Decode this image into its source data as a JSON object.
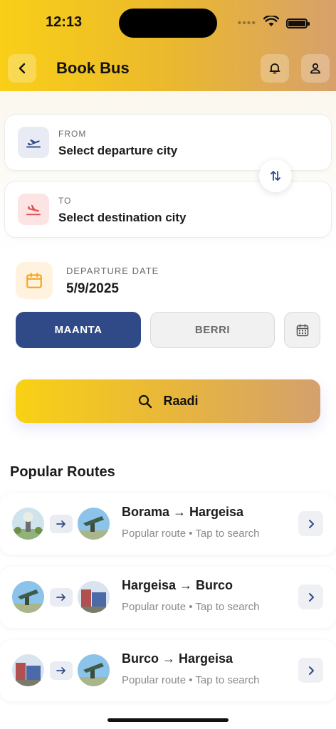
{
  "status_bar": {
    "time": "12:13",
    "signal_dots": "••••"
  },
  "header": {
    "title": "Book Bus"
  },
  "from": {
    "label": "FROM",
    "placeholder": "Select departure city"
  },
  "to": {
    "label": "TO",
    "placeholder": "Select destination city"
  },
  "date": {
    "label": "DEPARTURE DATE",
    "value": "5/9/2025"
  },
  "day_toggle": {
    "today_label": "MAANTA",
    "tomorrow_label": "BERRI"
  },
  "search": {
    "label": "Raadi"
  },
  "popular": {
    "title": "Popular Routes",
    "routes": [
      {
        "name": "Borama → Hargeisa",
        "subtitle": "Popular route • Tap to search"
      },
      {
        "name": "Hargeisa → Burco",
        "subtitle": "Popular route • Tap to search"
      },
      {
        "name": "Burco → Hargeisa",
        "subtitle": "Popular route • Tap to search"
      }
    ]
  },
  "colors": {
    "header_gradient_start": "#f9cf17",
    "header_gradient_end": "#d7a06c",
    "primary_blue": "#2f4a87",
    "from_icon_bg": "#e8ebf4",
    "to_icon": "#e05252",
    "date_icon": "#f5a623"
  },
  "icons": {
    "back": "chevron-left-icon",
    "notifications": "bell-icon",
    "profile": "user-icon",
    "departure": "plane-takeoff-icon",
    "arrival": "plane-landing-icon",
    "swap": "swap-vertical-icon",
    "date": "calendar-icon",
    "search": "search-icon",
    "route_arrow": "arrow-right-icon",
    "route_open": "chevron-right-icon"
  }
}
